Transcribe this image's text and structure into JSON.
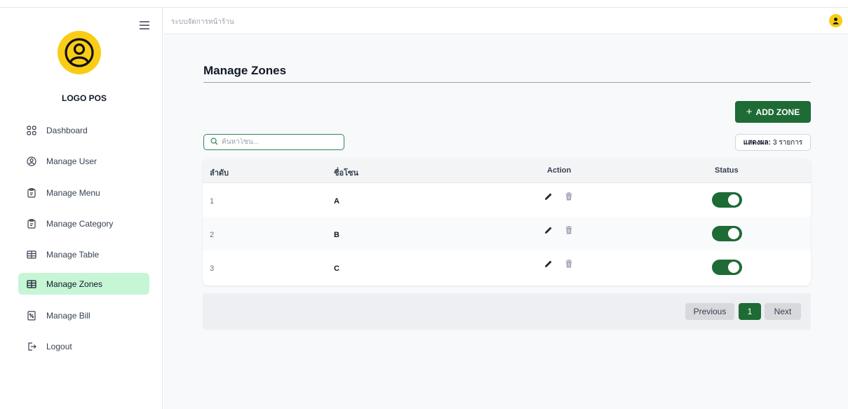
{
  "header": {
    "title": "ระบบจัดการหน้าร้าน"
  },
  "sidebar": {
    "logo_text": "LOGO POS",
    "items": [
      {
        "label": "Dashboard",
        "icon": "dashboard-grid-icon"
      },
      {
        "label": "Manage User",
        "icon": "user-circle-icon"
      },
      {
        "label": "Manage Menu",
        "icon": "clipboard-icon"
      },
      {
        "label": "Manage Category",
        "icon": "clipboard-icon"
      },
      {
        "label": "Manage Table",
        "icon": "table-icon"
      },
      {
        "label": "Manage Zones",
        "icon": "table-icon",
        "active": true
      },
      {
        "label": "Manage Bill",
        "icon": "receipt-percent-icon"
      },
      {
        "label": "Logout",
        "icon": "logout-icon"
      }
    ]
  },
  "main": {
    "title": "Manage Zones",
    "add_button": "ADD ZONE",
    "search_placeholder": "ค้นหาโซน...",
    "count_label": "แสดงผล:",
    "count_value": "3 รายการ",
    "columns": {
      "no": "ลำดับ",
      "name": "ชื่อโซน",
      "action": "Action",
      "status": "Status"
    },
    "rows": [
      {
        "no": "1",
        "name": "A",
        "status": "on"
      },
      {
        "no": "2",
        "name": "B",
        "status": "on"
      },
      {
        "no": "3",
        "name": "C",
        "status": "on"
      }
    ],
    "pagination": {
      "prev": "Previous",
      "page": "1",
      "next": "Next"
    }
  },
  "colors": {
    "primary": "#1e6b35",
    "accent": "#facc15",
    "active_nav": "#c6f6d5"
  }
}
